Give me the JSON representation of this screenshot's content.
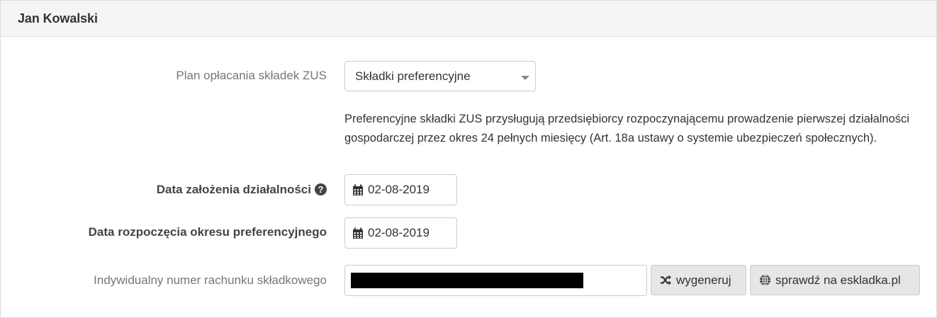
{
  "panel": {
    "title": "Jan Kowalski"
  },
  "form": {
    "plan": {
      "label": "Plan opłacania składek ZUS",
      "value": "Składki preferencyjne",
      "help": "Preferencyjne składki ZUS przysługują przedsiębiorcy rozpoczynającemu prowadzenie pierwszej działalności gospodarczej przez okres 24 pełnych miesięcy (Art. 18a ustawy o systemie ubezpieczeń społecznych)."
    },
    "founding_date": {
      "label": "Data założenia działalności",
      "value": "02-08-2019"
    },
    "pref_start_date": {
      "label": "Data rozpoczęcia okresu preferencyjnego",
      "value": "02-08-2019"
    },
    "account": {
      "label": "Indywidualny numer rachunku składkowego",
      "generate_label": "wygeneruj",
      "check_label": "sprawdź na eskladka.pl"
    }
  },
  "icons": {
    "help": "question-circle-icon",
    "calendar": "calendar-icon",
    "generate": "random-icon",
    "check": "globe-icon"
  }
}
